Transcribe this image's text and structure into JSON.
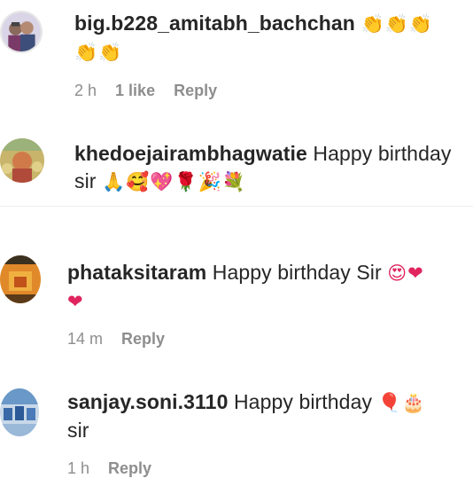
{
  "colors": {
    "username": "#262626",
    "meta": "#8e8e8e",
    "background": "#ffffff"
  },
  "comments": [
    {
      "username": "big.b228_amitabh_bachchan",
      "text": "",
      "emojis_line1": "👏👏👏",
      "emojis_line2": "👏👏",
      "time": "2 h",
      "likes": "1 like",
      "reply": "Reply",
      "avatar": "avatar-two-people"
    },
    {
      "username": "khedoejairambhagwatie",
      "text": "Happy birthday",
      "text2": "sir",
      "emojis": "🙏🥰💖🌹🎉💐",
      "avatar": "avatar-deity"
    },
    {
      "username": "phataksitaram",
      "text": "Happy birthday Sir",
      "emojis_inline": "😍❤",
      "emojis_line2": "❤",
      "time": "14 m",
      "reply": "Reply",
      "avatar": "avatar-orange-shrine"
    },
    {
      "username": "sanjay.soni.3110",
      "text": "Happy birthday",
      "emojis_inline": "🎈🎂",
      "text2": "sir",
      "time": "1 h",
      "reply": "Reply",
      "avatar": "avatar-group-blue"
    }
  ]
}
